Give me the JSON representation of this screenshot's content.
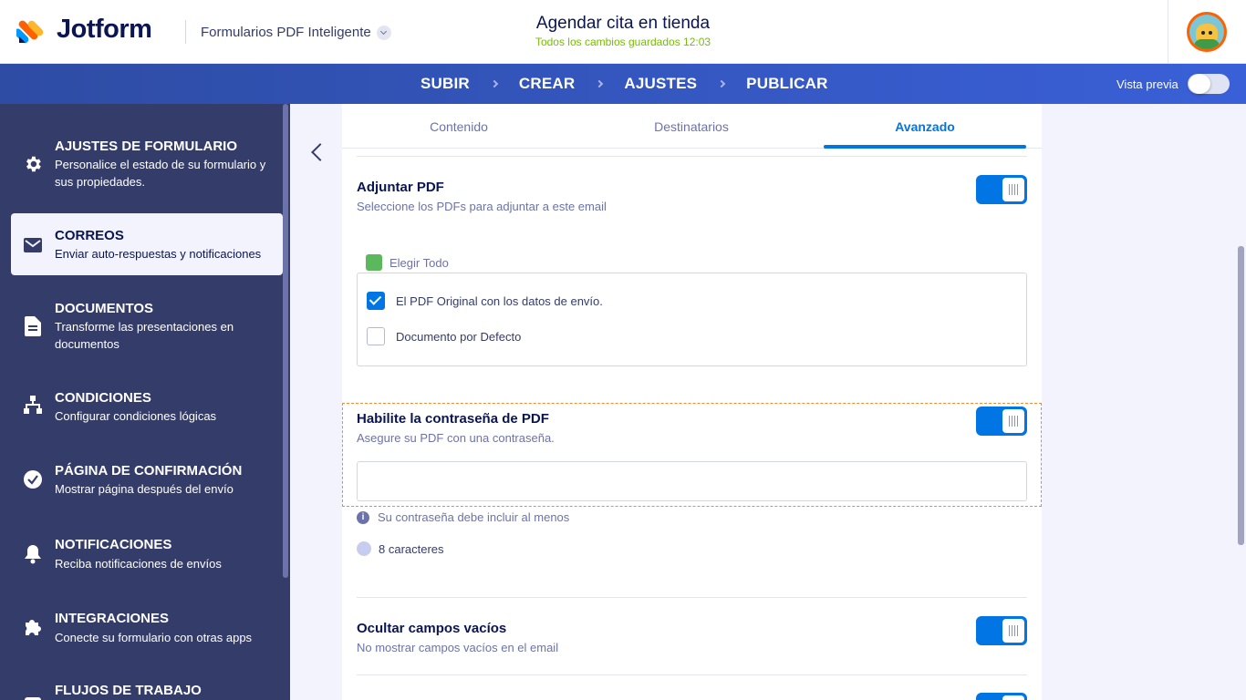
{
  "header": {
    "logo_text": "Jotform",
    "product_name": "Formularios PDF Inteligente",
    "form_title": "Agendar cita en tienda",
    "save_status": "Todos los cambios guardados 12:03"
  },
  "nav": {
    "steps": [
      "SUBIR",
      "CREAR",
      "AJUSTES",
      "PUBLICAR"
    ],
    "preview_label": "Vista previa"
  },
  "sidebar": {
    "items": [
      {
        "title": "AJUSTES DE FORMULARIO",
        "desc": "Personalice el estado de su formulario y sus propiedades.",
        "icon": "gear-icon"
      },
      {
        "title": "CORREOS",
        "desc": "Enviar auto-respuestas y notificaciones",
        "icon": "envelope-icon"
      },
      {
        "title": "DOCUMENTOS",
        "desc": "Transforme las presentaciones en documentos",
        "icon": "document-icon"
      },
      {
        "title": "CONDICIONES",
        "desc": "Configurar condiciones lógicas",
        "icon": "sitemap-icon"
      },
      {
        "title": "PÁGINA DE CONFIRMACIÓN",
        "desc": "Mostrar página después del envío",
        "icon": "check-circle-icon"
      },
      {
        "title": "NOTIFICACIONES",
        "desc": "Reciba notificaciones de envíos",
        "icon": "bell-icon"
      },
      {
        "title": "INTEGRACIONES",
        "desc": "Conecte su formulario con otras apps",
        "icon": "puzzle-icon"
      },
      {
        "title": "FLUJOS DE TRABAJO",
        "desc": "",
        "icon": "workflow-icon"
      }
    ]
  },
  "tabs": [
    "Contenido",
    "Destinatarios",
    "Avanzado"
  ],
  "attach_pdf": {
    "title": "Adjuntar PDF",
    "desc": "Seleccione los PDFs para adjuntar a este email",
    "select_all": "Elegir Todo",
    "options": [
      {
        "label": "El PDF Original con los datos de envío.",
        "checked": true
      },
      {
        "label": "Documento por Defecto",
        "checked": false
      }
    ]
  },
  "pdf_password": {
    "title": "Habilite la contraseña de PDF",
    "desc": "Asegure su PDF con una contraseña.",
    "value": "",
    "hint": "Su contraseña debe incluir al menos",
    "requirement": "8 caracteres",
    "info_glyph": "i"
  },
  "hide_empty": {
    "title": "Ocultar campos vacíos",
    "desc": "No mostrar campos vacíos en el email"
  },
  "colors": {
    "accent": "#0075e3",
    "sidebar": "#343c6a",
    "highlight": "#f28a2e",
    "saved": "#78bb07"
  }
}
